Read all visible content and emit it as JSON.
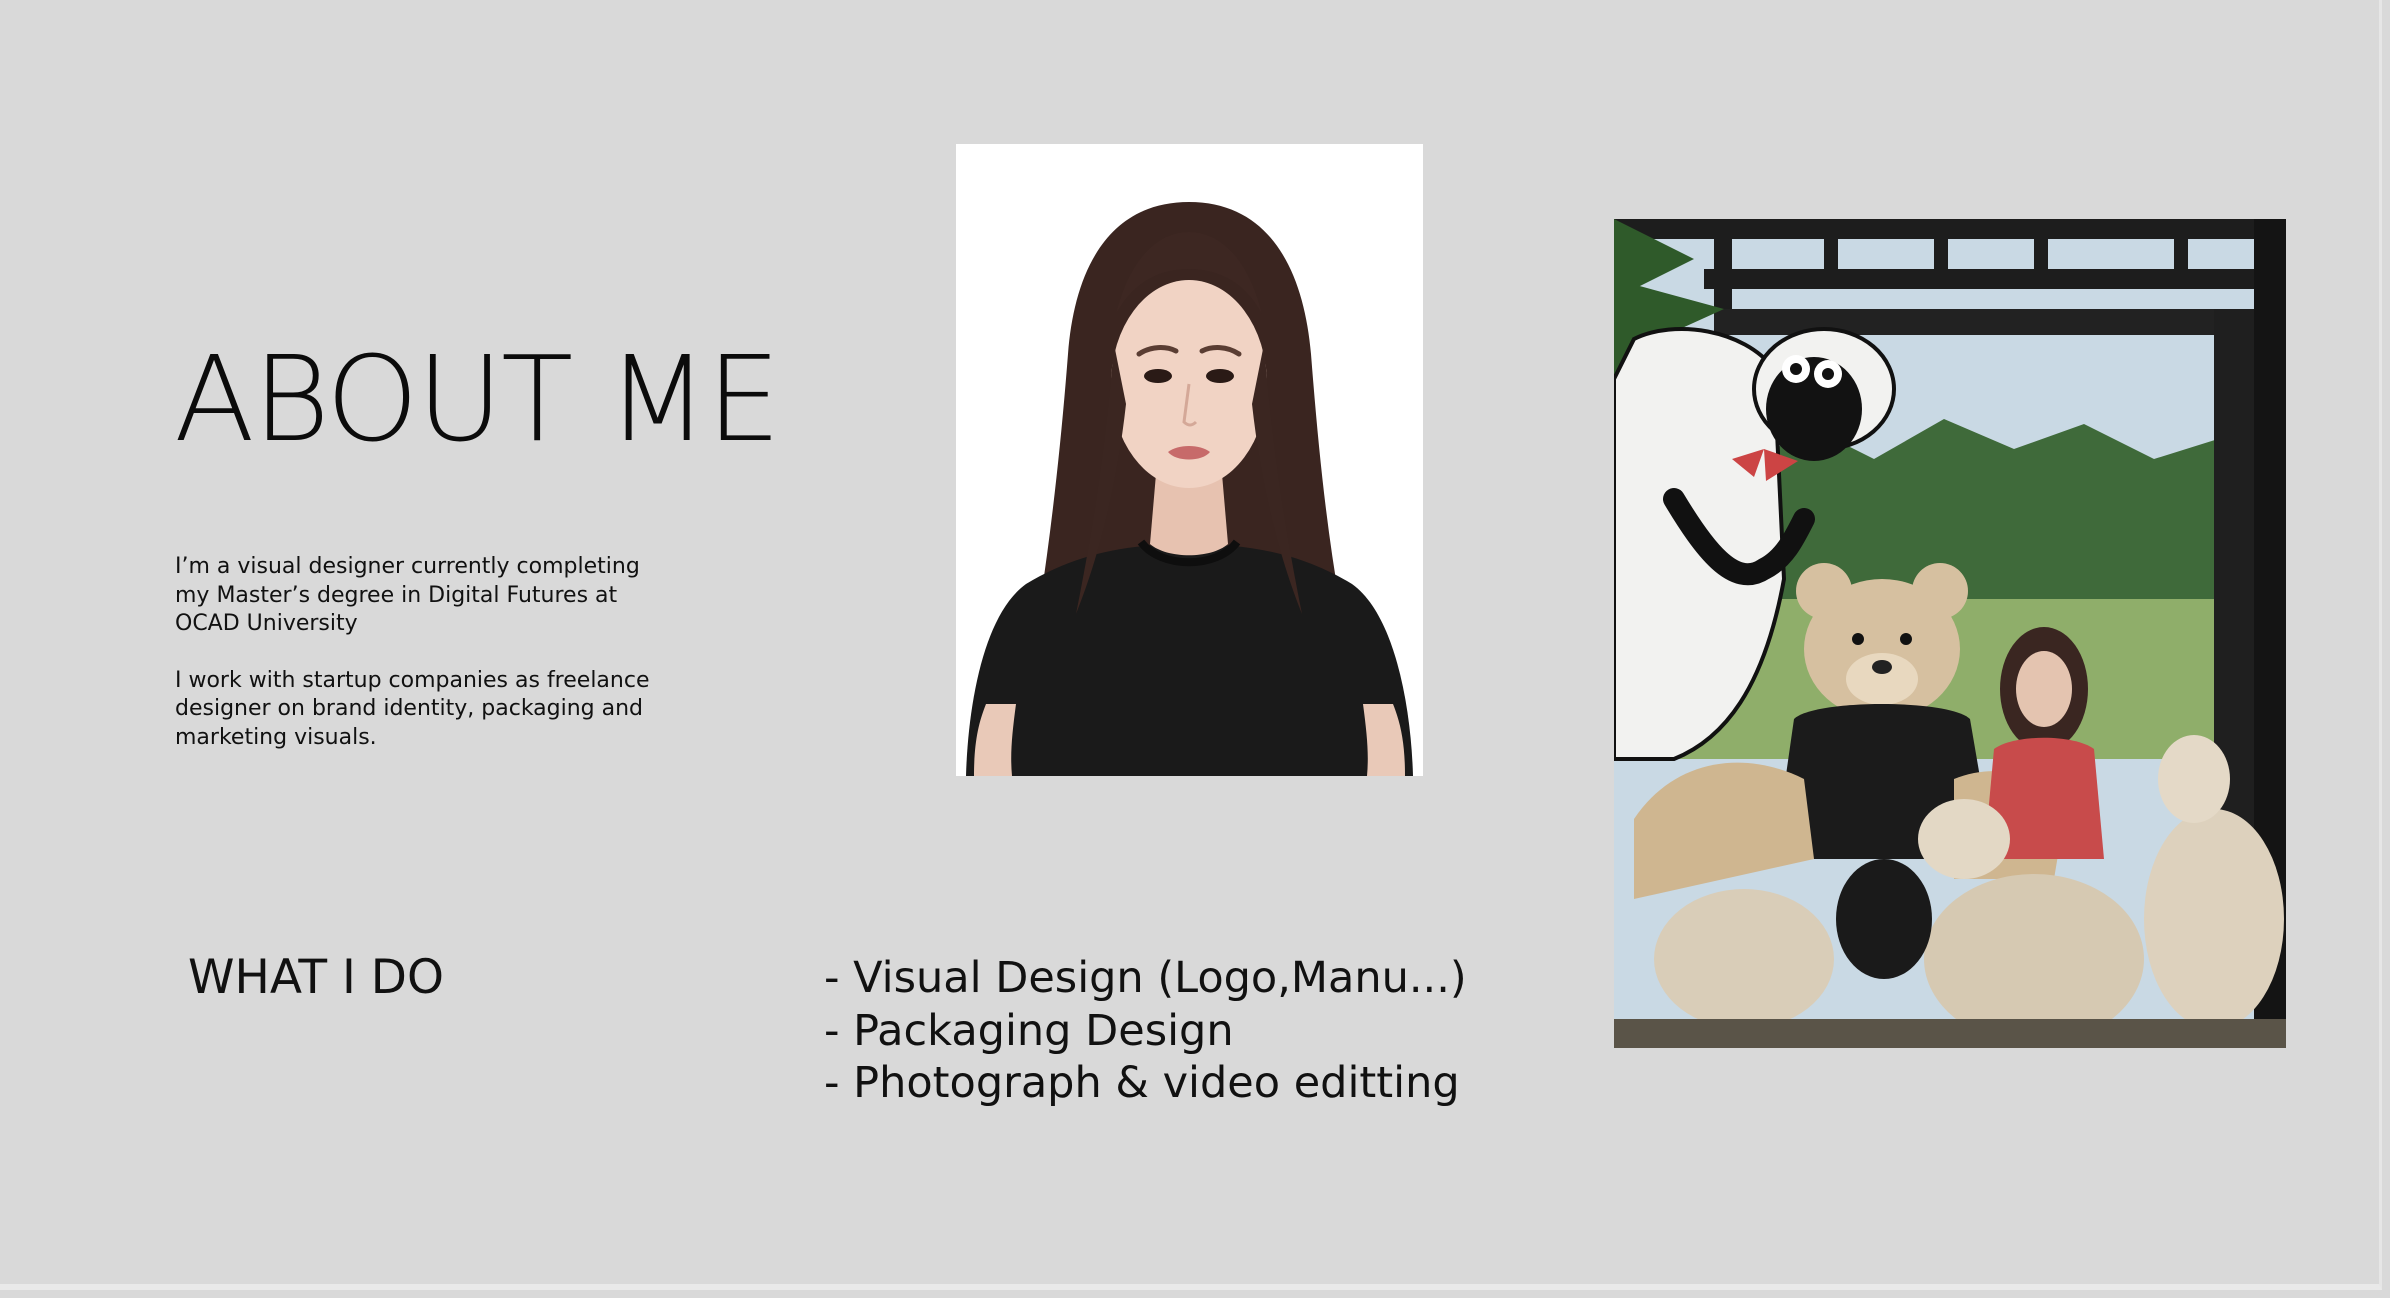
{
  "page": {
    "title": "ABOUT ME",
    "bio": [
      " I’m a visual designer currently completing my Master’s degree in Digital Futures at OCAD University",
      " I work with startup companies as freelance designer on brand identity, packaging and marketing visuals."
    ],
    "what_i_do": {
      "heading": "WHAT I DO",
      "items": [
        "- Visual Design (Logo,Manu...)",
        "- Packaging Design",
        "- Photograph & video editting"
      ]
    }
  },
  "colors": {
    "background": "#d9d9d9",
    "text": "#111111"
  }
}
